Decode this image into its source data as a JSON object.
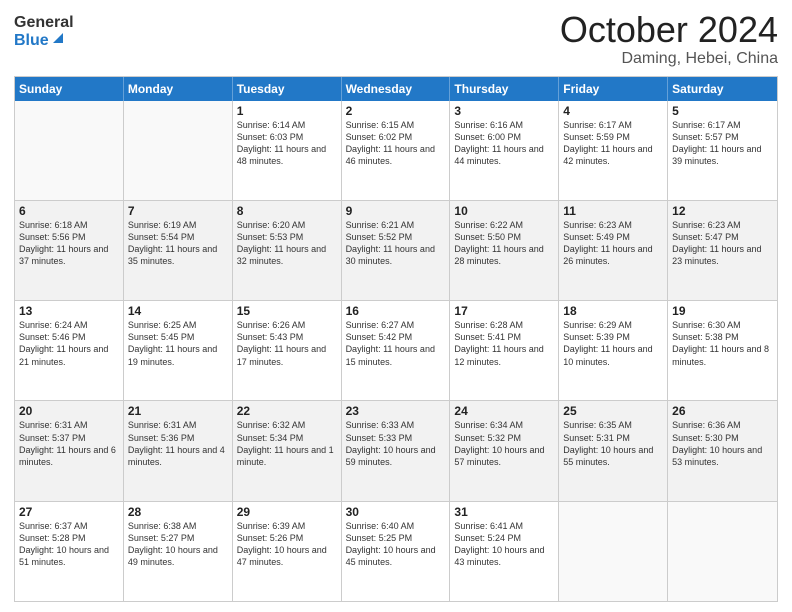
{
  "header": {
    "logo_line1": "General",
    "logo_line2": "Blue",
    "month": "October 2024",
    "location": "Daming, Hebei, China"
  },
  "weekdays": [
    "Sunday",
    "Monday",
    "Tuesday",
    "Wednesday",
    "Thursday",
    "Friday",
    "Saturday"
  ],
  "rows": [
    [
      {
        "day": "",
        "sunrise": "",
        "sunset": "",
        "daylight": "",
        "alt": false
      },
      {
        "day": "",
        "sunrise": "",
        "sunset": "",
        "daylight": "",
        "alt": false
      },
      {
        "day": "1",
        "sunrise": "Sunrise: 6:14 AM",
        "sunset": "Sunset: 6:03 PM",
        "daylight": "Daylight: 11 hours and 48 minutes.",
        "alt": false
      },
      {
        "day": "2",
        "sunrise": "Sunrise: 6:15 AM",
        "sunset": "Sunset: 6:02 PM",
        "daylight": "Daylight: 11 hours and 46 minutes.",
        "alt": false
      },
      {
        "day": "3",
        "sunrise": "Sunrise: 6:16 AM",
        "sunset": "Sunset: 6:00 PM",
        "daylight": "Daylight: 11 hours and 44 minutes.",
        "alt": false
      },
      {
        "day": "4",
        "sunrise": "Sunrise: 6:17 AM",
        "sunset": "Sunset: 5:59 PM",
        "daylight": "Daylight: 11 hours and 42 minutes.",
        "alt": false
      },
      {
        "day": "5",
        "sunrise": "Sunrise: 6:17 AM",
        "sunset": "Sunset: 5:57 PM",
        "daylight": "Daylight: 11 hours and 39 minutes.",
        "alt": false
      }
    ],
    [
      {
        "day": "6",
        "sunrise": "Sunrise: 6:18 AM",
        "sunset": "Sunset: 5:56 PM",
        "daylight": "Daylight: 11 hours and 37 minutes.",
        "alt": true
      },
      {
        "day": "7",
        "sunrise": "Sunrise: 6:19 AM",
        "sunset": "Sunset: 5:54 PM",
        "daylight": "Daylight: 11 hours and 35 minutes.",
        "alt": true
      },
      {
        "day": "8",
        "sunrise": "Sunrise: 6:20 AM",
        "sunset": "Sunset: 5:53 PM",
        "daylight": "Daylight: 11 hours and 32 minutes.",
        "alt": true
      },
      {
        "day": "9",
        "sunrise": "Sunrise: 6:21 AM",
        "sunset": "Sunset: 5:52 PM",
        "daylight": "Daylight: 11 hours and 30 minutes.",
        "alt": true
      },
      {
        "day": "10",
        "sunrise": "Sunrise: 6:22 AM",
        "sunset": "Sunset: 5:50 PM",
        "daylight": "Daylight: 11 hours and 28 minutes.",
        "alt": true
      },
      {
        "day": "11",
        "sunrise": "Sunrise: 6:23 AM",
        "sunset": "Sunset: 5:49 PM",
        "daylight": "Daylight: 11 hours and 26 minutes.",
        "alt": true
      },
      {
        "day": "12",
        "sunrise": "Sunrise: 6:23 AM",
        "sunset": "Sunset: 5:47 PM",
        "daylight": "Daylight: 11 hours and 23 minutes.",
        "alt": true
      }
    ],
    [
      {
        "day": "13",
        "sunrise": "Sunrise: 6:24 AM",
        "sunset": "Sunset: 5:46 PM",
        "daylight": "Daylight: 11 hours and 21 minutes.",
        "alt": false
      },
      {
        "day": "14",
        "sunrise": "Sunrise: 6:25 AM",
        "sunset": "Sunset: 5:45 PM",
        "daylight": "Daylight: 11 hours and 19 minutes.",
        "alt": false
      },
      {
        "day": "15",
        "sunrise": "Sunrise: 6:26 AM",
        "sunset": "Sunset: 5:43 PM",
        "daylight": "Daylight: 11 hours and 17 minutes.",
        "alt": false
      },
      {
        "day": "16",
        "sunrise": "Sunrise: 6:27 AM",
        "sunset": "Sunset: 5:42 PM",
        "daylight": "Daylight: 11 hours and 15 minutes.",
        "alt": false
      },
      {
        "day": "17",
        "sunrise": "Sunrise: 6:28 AM",
        "sunset": "Sunset: 5:41 PM",
        "daylight": "Daylight: 11 hours and 12 minutes.",
        "alt": false
      },
      {
        "day": "18",
        "sunrise": "Sunrise: 6:29 AM",
        "sunset": "Sunset: 5:39 PM",
        "daylight": "Daylight: 11 hours and 10 minutes.",
        "alt": false
      },
      {
        "day": "19",
        "sunrise": "Sunrise: 6:30 AM",
        "sunset": "Sunset: 5:38 PM",
        "daylight": "Daylight: 11 hours and 8 minutes.",
        "alt": false
      }
    ],
    [
      {
        "day": "20",
        "sunrise": "Sunrise: 6:31 AM",
        "sunset": "Sunset: 5:37 PM",
        "daylight": "Daylight: 11 hours and 6 minutes.",
        "alt": true
      },
      {
        "day": "21",
        "sunrise": "Sunrise: 6:31 AM",
        "sunset": "Sunset: 5:36 PM",
        "daylight": "Daylight: 11 hours and 4 minutes.",
        "alt": true
      },
      {
        "day": "22",
        "sunrise": "Sunrise: 6:32 AM",
        "sunset": "Sunset: 5:34 PM",
        "daylight": "Daylight: 11 hours and 1 minute.",
        "alt": true
      },
      {
        "day": "23",
        "sunrise": "Sunrise: 6:33 AM",
        "sunset": "Sunset: 5:33 PM",
        "daylight": "Daylight: 10 hours and 59 minutes.",
        "alt": true
      },
      {
        "day": "24",
        "sunrise": "Sunrise: 6:34 AM",
        "sunset": "Sunset: 5:32 PM",
        "daylight": "Daylight: 10 hours and 57 minutes.",
        "alt": true
      },
      {
        "day": "25",
        "sunrise": "Sunrise: 6:35 AM",
        "sunset": "Sunset: 5:31 PM",
        "daylight": "Daylight: 10 hours and 55 minutes.",
        "alt": true
      },
      {
        "day": "26",
        "sunrise": "Sunrise: 6:36 AM",
        "sunset": "Sunset: 5:30 PM",
        "daylight": "Daylight: 10 hours and 53 minutes.",
        "alt": true
      }
    ],
    [
      {
        "day": "27",
        "sunrise": "Sunrise: 6:37 AM",
        "sunset": "Sunset: 5:28 PM",
        "daylight": "Daylight: 10 hours and 51 minutes.",
        "alt": false
      },
      {
        "day": "28",
        "sunrise": "Sunrise: 6:38 AM",
        "sunset": "Sunset: 5:27 PM",
        "daylight": "Daylight: 10 hours and 49 minutes.",
        "alt": false
      },
      {
        "day": "29",
        "sunrise": "Sunrise: 6:39 AM",
        "sunset": "Sunset: 5:26 PM",
        "daylight": "Daylight: 10 hours and 47 minutes.",
        "alt": false
      },
      {
        "day": "30",
        "sunrise": "Sunrise: 6:40 AM",
        "sunset": "Sunset: 5:25 PM",
        "daylight": "Daylight: 10 hours and 45 minutes.",
        "alt": false
      },
      {
        "day": "31",
        "sunrise": "Sunrise: 6:41 AM",
        "sunset": "Sunset: 5:24 PM",
        "daylight": "Daylight: 10 hours and 43 minutes.",
        "alt": false
      },
      {
        "day": "",
        "sunrise": "",
        "sunset": "",
        "daylight": "",
        "alt": false
      },
      {
        "day": "",
        "sunrise": "",
        "sunset": "",
        "daylight": "",
        "alt": false
      }
    ]
  ]
}
